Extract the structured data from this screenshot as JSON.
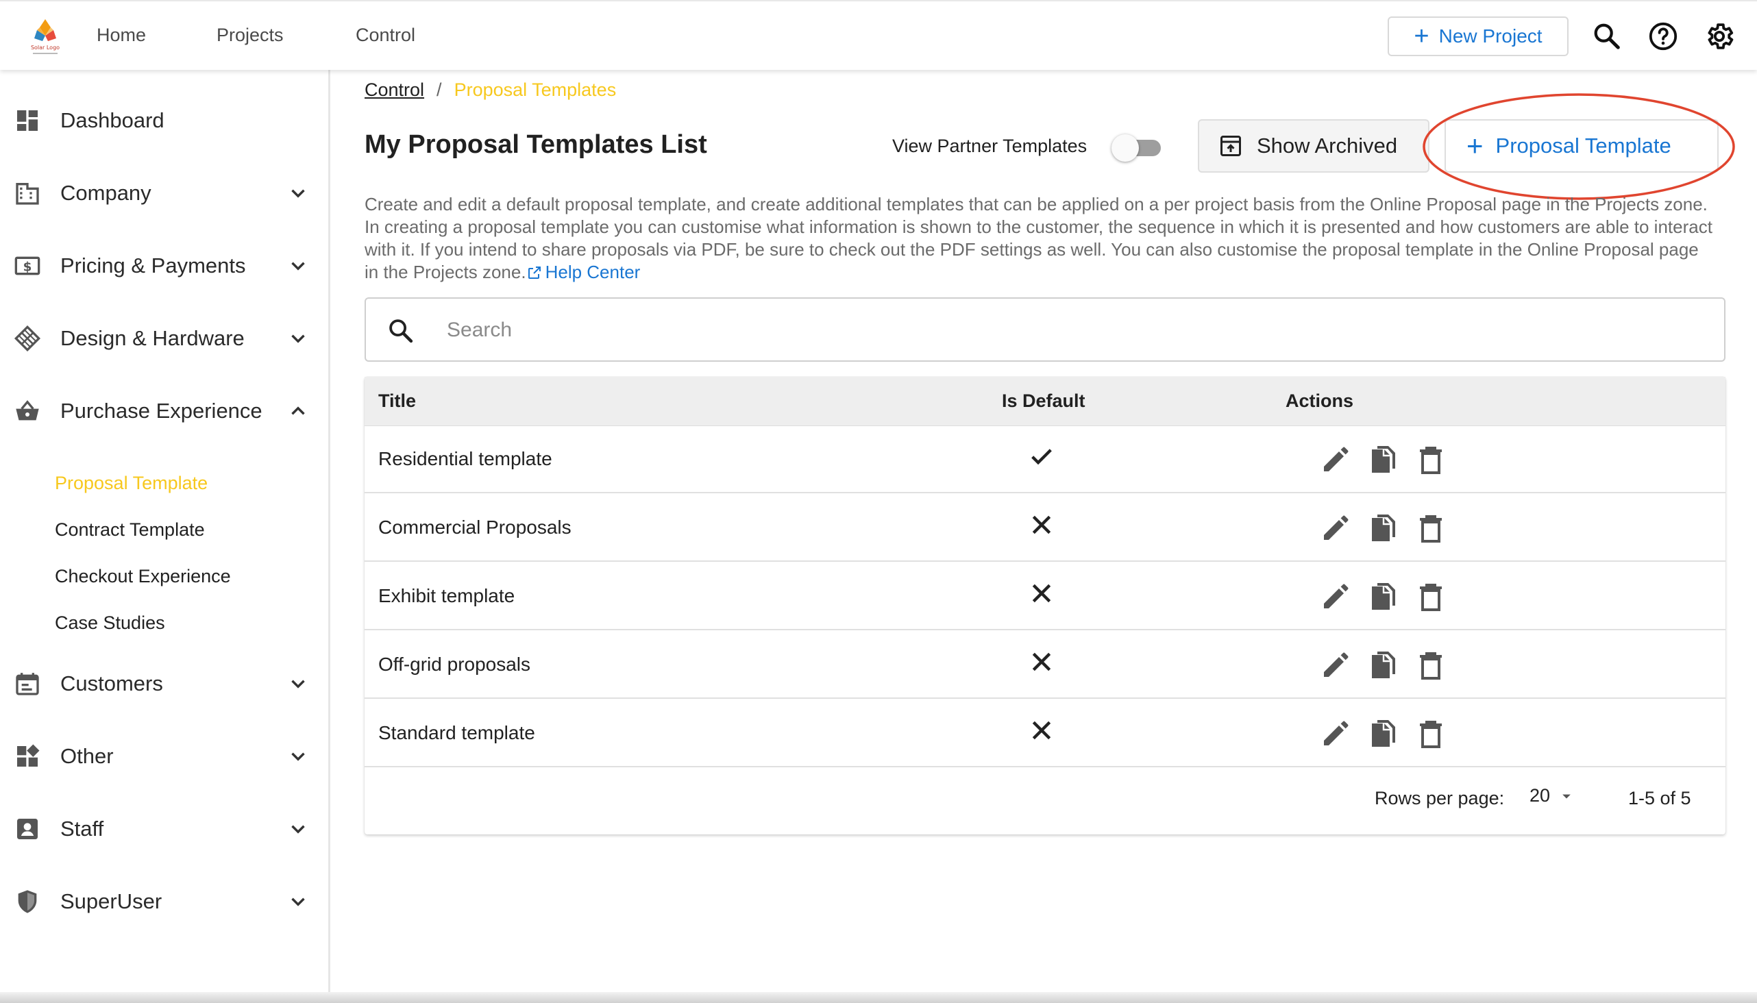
{
  "topbar": {
    "logo_text": "Solar Logo",
    "nav": [
      "Home",
      "Projects",
      "Control"
    ],
    "new_project_label": "New Project"
  },
  "sidebar": {
    "items": [
      {
        "label": "Dashboard",
        "icon": "dashboard-icon",
        "chevron": "none"
      },
      {
        "label": "Company",
        "icon": "building-icon",
        "chevron": "down"
      },
      {
        "label": "Pricing & Payments",
        "icon": "dollar-icon",
        "chevron": "down"
      },
      {
        "label": "Design & Hardware",
        "icon": "grid-diamond-icon",
        "chevron": "down"
      },
      {
        "label": "Purchase Experience",
        "icon": "basket-icon",
        "chevron": "up"
      },
      {
        "label": "Customers",
        "icon": "calendar-icon",
        "chevron": "down"
      },
      {
        "label": "Other",
        "icon": "widgets-icon",
        "chevron": "down"
      },
      {
        "label": "Staff",
        "icon": "person-badge-icon",
        "chevron": "down"
      },
      {
        "label": "SuperUser",
        "icon": "shield-icon",
        "chevron": "down"
      }
    ],
    "sub_items": [
      {
        "label": "Proposal Template",
        "active": true
      },
      {
        "label": "Contract Template",
        "active": false
      },
      {
        "label": "Checkout Experience",
        "active": false
      },
      {
        "label": "Case Studies",
        "active": false
      }
    ]
  },
  "breadcrumb": {
    "parent": "Control",
    "separator": "/",
    "current": "Proposal Templates"
  },
  "page": {
    "title": "My Proposal Templates List",
    "partner_toggle_label": "View Partner Templates",
    "partner_toggle_on": false,
    "show_archived_label": "Show Archived",
    "add_template_label": "Proposal Template",
    "description": "Create and edit a default proposal template, and create additional templates that can be applied on a per project basis from the Online Proposal page in the Projects zone. In creating a proposal template you can customise what information is shown to the customer, the sequence in which it is presented and how customers are able to interact with it. If you intend to share proposals via PDF, be sure to check out the PDF settings as well. You can also customise the proposal template in the Online Proposal page in the Projects zone.",
    "help_link": "Help Center"
  },
  "search": {
    "placeholder": "Search",
    "value": ""
  },
  "table": {
    "columns": [
      "Title",
      "Is Default",
      "Actions"
    ],
    "rows": [
      {
        "title": "Residential template",
        "is_default": true
      },
      {
        "title": "Commercial Proposals",
        "is_default": false
      },
      {
        "title": "Exhibit template",
        "is_default": false
      },
      {
        "title": "Off-grid proposals",
        "is_default": false
      },
      {
        "title": "Standard template",
        "is_default": false
      }
    ],
    "rows_per_page_label": "Rows per page:",
    "rows_per_page": "20",
    "page_info": "1-5 of 5"
  },
  "colors": {
    "accent_blue": "#1976d2",
    "active_yellow": "#f7c81e",
    "highlight_red": "#e0452f"
  }
}
